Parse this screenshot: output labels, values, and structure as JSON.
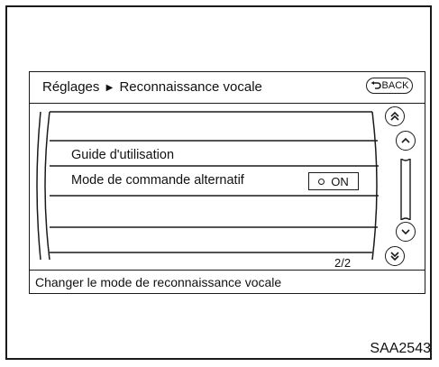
{
  "header": {
    "breadcrumb_parent": "Réglages",
    "breadcrumb_current": "Reconnaissance vocale",
    "back_label": "BACK"
  },
  "list": {
    "items": [
      {
        "label": ""
      },
      {
        "label": "Guide d'utilisation"
      },
      {
        "label": "Mode de commande alternatif",
        "value": "ON"
      },
      {
        "label": ""
      },
      {
        "label": ""
      }
    ],
    "page_indicator": "2/2"
  },
  "footer": {
    "status_text": "Changer le mode de reconnaissance vocale"
  },
  "figure_code": "SAA2543",
  "icons": {
    "back": "back-arrow-icon",
    "page_up": "double-chevron-up-icon",
    "line_up": "chevron-up-icon",
    "line_down": "chevron-down-icon",
    "page_down": "double-chevron-down-icon",
    "indicator": "circle-indicator-icon"
  }
}
